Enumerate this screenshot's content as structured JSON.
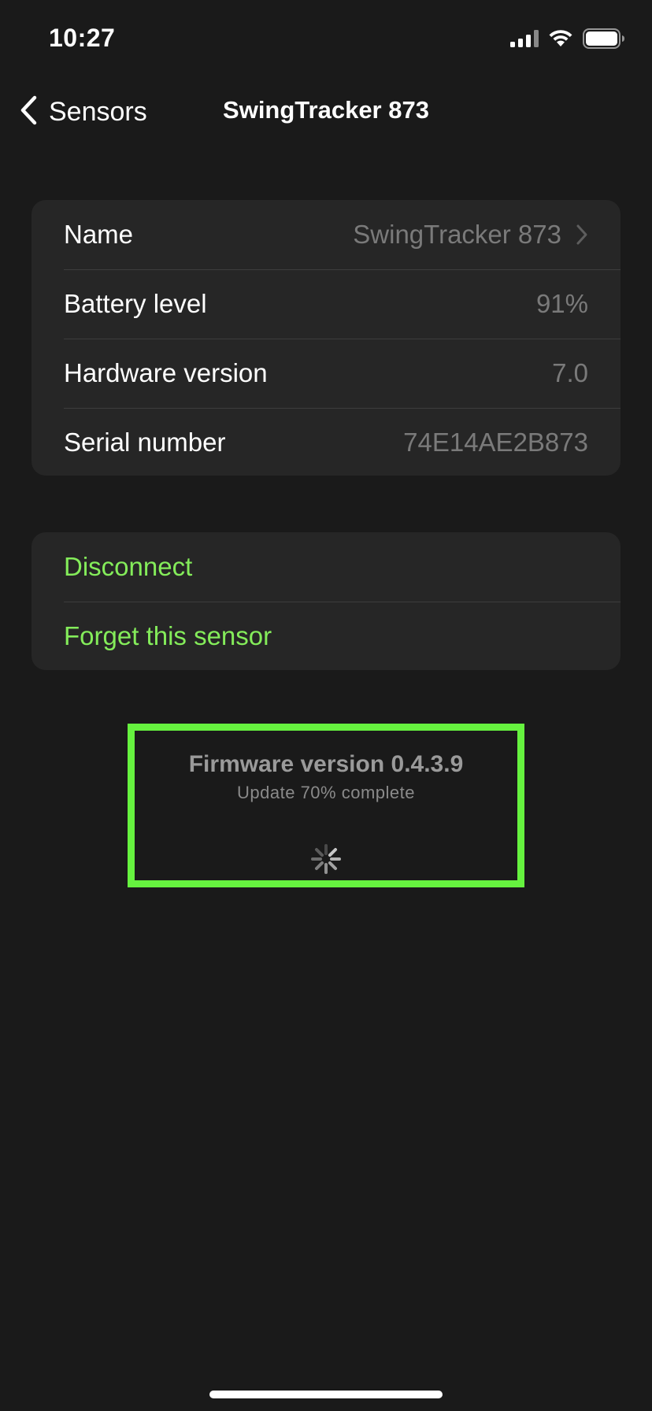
{
  "status_bar": {
    "time": "10:27",
    "icons": [
      "signal-icon",
      "wifi-icon",
      "battery-icon"
    ]
  },
  "nav": {
    "back_label": "Sensors",
    "title": "SwingTracker 873"
  },
  "info_rows": [
    {
      "label": "Name",
      "value": "SwingTracker 873",
      "chevron": true
    },
    {
      "label": "Battery level",
      "value": "91%"
    },
    {
      "label": "Hardware version",
      "value": "7.0"
    },
    {
      "label": "Serial number",
      "value": "74E14AE2B873"
    }
  ],
  "actions": [
    {
      "label": "Disconnect"
    },
    {
      "label": "Forget this sensor"
    }
  ],
  "firmware": {
    "title": "Firmware version 0.4.3.9",
    "status": "Update 70% complete",
    "progress_percent": 70
  },
  "colors": {
    "background": "#1a1a1a",
    "card": "#262626",
    "accent_green": "#84ec5a",
    "highlight_border": "#66f23f",
    "secondary_text": "#7a7a7a"
  }
}
